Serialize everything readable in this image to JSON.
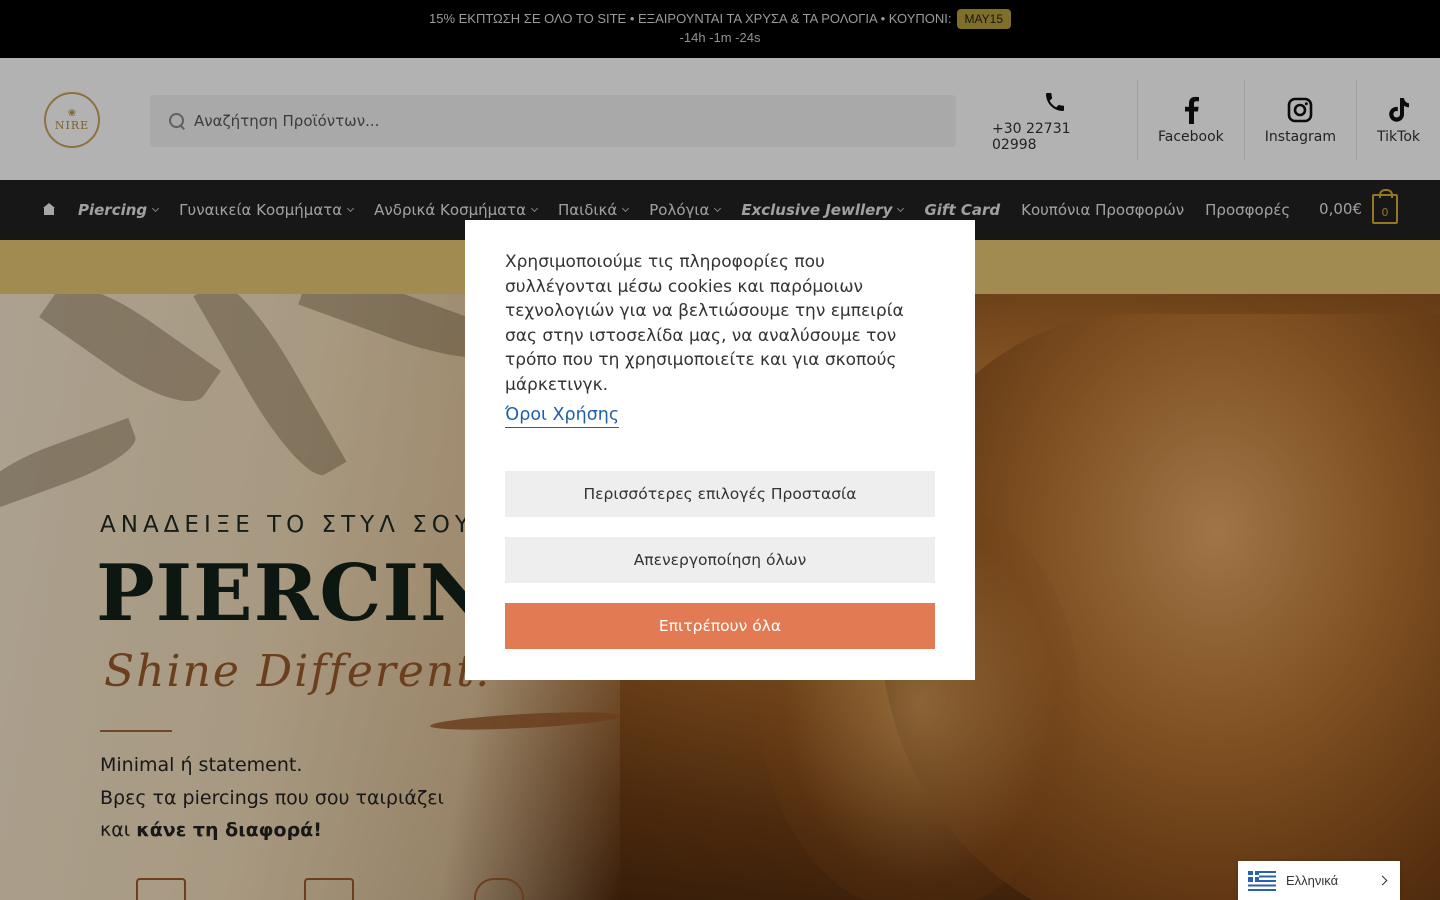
{
  "promo": {
    "text": "15% ΕΚΠΤΩΣΗ ΣΕ ΟΛΟ ΤΟ SITE • ΕΞΑΙΡΟΥΝΤΑΙ ΤΑ ΧΡΥΣΑ & ΤΑ ΡΟΛΟΓΙΑ • ΚΟΥΠΟΝΙ:",
    "code": "MAY15",
    "countdown": "-14h -1m -24s"
  },
  "header": {
    "logo_text": "NIRE",
    "search_placeholder": "Αναζήτηση Προϊόντων...",
    "contacts": [
      {
        "label": "+30 22731 02998",
        "icon": "phone-icon"
      },
      {
        "label": "Facebook",
        "icon": "facebook-icon"
      },
      {
        "label": "Instagram",
        "icon": "instagram-icon"
      },
      {
        "label": "TikTok",
        "icon": "tiktok-icon"
      }
    ]
  },
  "nav": {
    "items": [
      {
        "label": "Piercing"
      },
      {
        "label": "Γυναικεία Κοσμήματα"
      },
      {
        "label": "Ανδρικά Κοσμήματα"
      },
      {
        "label": "Παιδικά"
      },
      {
        "label": "Ρολόγια"
      },
      {
        "label": "Exclusive Jewllery"
      },
      {
        "label": "Gift Card"
      },
      {
        "label": "Κουπόνια Προσφορών"
      },
      {
        "label": "Προσφορές"
      }
    ],
    "cart_total": "0,00€",
    "cart_count": "0"
  },
  "hero": {
    "kicker": "ΑΝΑΔΕΙΞΕ ΤΟ ΣΤΥΛ ΣΟΥ",
    "title": "PIERCING",
    "script": "Shine Different!",
    "line1": "Minimal ή statement.",
    "line2": "Βρες τα piercings που σου ταιριάζει",
    "line3_pre": "και ",
    "line3_bold": "κάνε τη διαφορά!"
  },
  "cookie": {
    "text": "Χρησιμοποιούμε τις πληροφορίες που συλλέγονται μέσω cookies και παρόμοιων τεχνολογιών για να βελτιώσουμε την εμπειρία σας στην ιστοσελίδα μας, να αναλύσουμε τον τρόπο που τη χρησιμοποιείτε και για σκοπούς μάρκετινγκ.",
    "terms_link": "Όροι Χρήσης",
    "btn_more": "Περισσότερες επιλογές Προστασία",
    "btn_deny": "Απενεργοποίηση όλων",
    "btn_allow": "Επιτρέπουν όλα"
  },
  "language": {
    "label": "Ελληνικά"
  },
  "colors": {
    "accent_gold": "#d4a935",
    "allow_button": "#e27a53",
    "link": "#1f5fa8"
  }
}
